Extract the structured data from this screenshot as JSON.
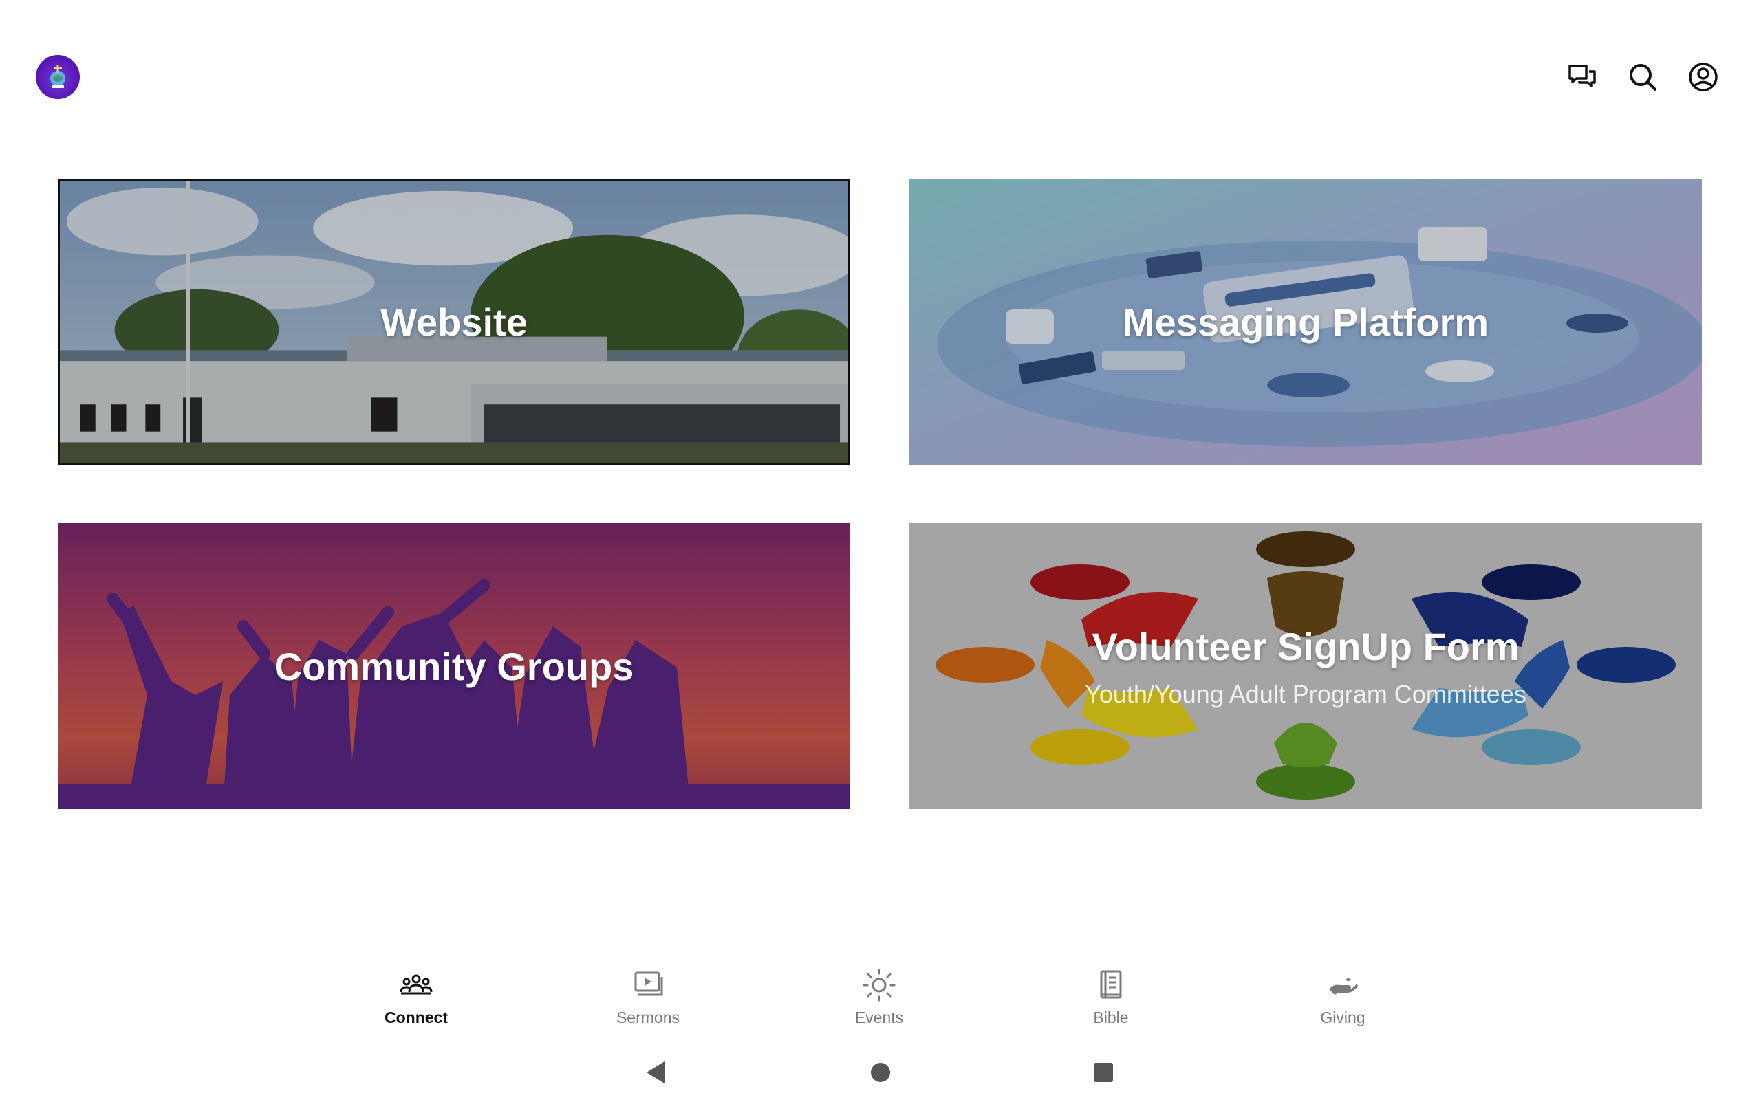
{
  "cards": [
    {
      "title": "Website",
      "subtitle": ""
    },
    {
      "title": "Messaging Platform",
      "subtitle": ""
    },
    {
      "title": "Community Groups",
      "subtitle": ""
    },
    {
      "title": "Volunteer SignUp Form",
      "subtitle": "Youth/Young Adult Program Committees"
    }
  ],
  "top_icons": [
    "chat-icon",
    "search-icon",
    "account-icon"
  ],
  "bottom_nav": [
    {
      "label": "Connect",
      "icon": "people-group-icon",
      "active": true
    },
    {
      "label": "Sermons",
      "icon": "video-library-icon",
      "active": false
    },
    {
      "label": "Events",
      "icon": "sun-icon",
      "active": false
    },
    {
      "label": "Bible",
      "icon": "book-icon",
      "active": false
    },
    {
      "label": "Giving",
      "icon": "giving-hand-icon",
      "active": false
    }
  ],
  "colors": {
    "accent": "#5a18b8",
    "active_text": "#111111",
    "inactive_text": "#7a7a7a"
  }
}
